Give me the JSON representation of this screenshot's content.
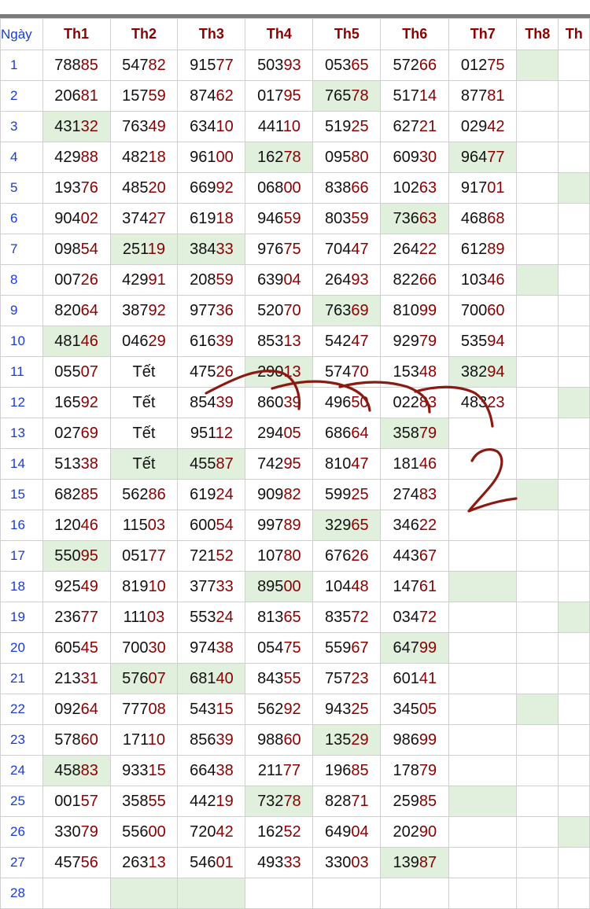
{
  "table": {
    "headers": [
      "Ngày",
      "Th1",
      "Th2",
      "Th3",
      "Th4",
      "Th5",
      "Th6",
      "Th7",
      "Th8",
      "Th"
    ],
    "rows": [
      {
        "day": "1",
        "cells": [
          "78885",
          "54782",
          "91577",
          "50393",
          "05365",
          "57266",
          "01275",
          "",
          ""
        ],
        "hl": [
          7
        ]
      },
      {
        "day": "2",
        "cells": [
          "20681",
          "15759",
          "87462",
          "01795",
          "76578",
          "51714",
          "87781",
          "",
          ""
        ],
        "hl": [
          4
        ]
      },
      {
        "day": "3",
        "cells": [
          "43132",
          "76349",
          "63410",
          "44110",
          "51925",
          "62721",
          "02942",
          "",
          ""
        ],
        "hl": [
          0
        ]
      },
      {
        "day": "4",
        "cells": [
          "42988",
          "48218",
          "96100",
          "16278",
          "09580",
          "60930",
          "96477",
          "",
          ""
        ],
        "hl": [
          3,
          6
        ]
      },
      {
        "day": "5",
        "cells": [
          "19376",
          "48520",
          "66992",
          "06800",
          "83866",
          "10263",
          "91701",
          "",
          ""
        ],
        "hl": [
          8
        ]
      },
      {
        "day": "6",
        "cells": [
          "90402",
          "37427",
          "61918",
          "94659",
          "80359",
          "73663",
          "46868",
          "",
          ""
        ],
        "hl": [
          5
        ]
      },
      {
        "day": "7",
        "cells": [
          "09854",
          "25119",
          "38433",
          "97675",
          "70447",
          "26422",
          "61289",
          "",
          ""
        ],
        "hl": [
          1,
          2
        ]
      },
      {
        "day": "8",
        "cells": [
          "00726",
          "42991",
          "20859",
          "63904",
          "26493",
          "82266",
          "10346",
          "",
          ""
        ],
        "hl": [
          7
        ]
      },
      {
        "day": "9",
        "cells": [
          "82064",
          "38792",
          "97736",
          "52070",
          "76369",
          "81099",
          "70060",
          "",
          ""
        ],
        "hl": [
          4
        ]
      },
      {
        "day": "10",
        "cells": [
          "48146",
          "04629",
          "61639",
          "85313",
          "54247",
          "92979",
          "53594",
          "",
          ""
        ],
        "hl": [
          0
        ]
      },
      {
        "day": "11",
        "cells": [
          "05507",
          "Tết",
          "47526",
          "29013",
          "57470",
          "15348",
          "38294",
          "",
          ""
        ],
        "hl": [
          3,
          6
        ]
      },
      {
        "day": "12",
        "cells": [
          "16592",
          "Tết",
          "85439",
          "86039",
          "49650",
          "02283",
          "48323",
          "",
          ""
        ],
        "hl": [
          8
        ]
      },
      {
        "day": "13",
        "cells": [
          "02769",
          "Tết",
          "95112",
          "29405",
          "68664",
          "35879",
          "",
          "",
          ""
        ],
        "hl": [
          5
        ]
      },
      {
        "day": "14",
        "cells": [
          "51338",
          "Tết",
          "45587",
          "74295",
          "81047",
          "18146",
          "",
          "",
          ""
        ],
        "hl": [
          1,
          2
        ]
      },
      {
        "day": "15",
        "cells": [
          "68285",
          "56286",
          "61924",
          "90982",
          "59925",
          "27483",
          "",
          "",
          ""
        ],
        "hl": [
          7
        ]
      },
      {
        "day": "16",
        "cells": [
          "12046",
          "11503",
          "60054",
          "99789",
          "32965",
          "34622",
          "",
          "",
          ""
        ],
        "hl": [
          4
        ]
      },
      {
        "day": "17",
        "cells": [
          "55095",
          "05177",
          "72152",
          "10780",
          "67626",
          "44367",
          "",
          "",
          ""
        ],
        "hl": [
          0
        ]
      },
      {
        "day": "18",
        "cells": [
          "92549",
          "81910",
          "37733",
          "89500",
          "10448",
          "14761",
          "",
          "",
          ""
        ],
        "hl": [
          3,
          6
        ]
      },
      {
        "day": "19",
        "cells": [
          "23677",
          "11103",
          "55324",
          "81365",
          "83572",
          "03472",
          "",
          "",
          ""
        ],
        "hl": [
          8
        ]
      },
      {
        "day": "20",
        "cells": [
          "60545",
          "70030",
          "97438",
          "05475",
          "55967",
          "64799",
          "",
          "",
          ""
        ],
        "hl": [
          5
        ]
      },
      {
        "day": "21",
        "cells": [
          "21331",
          "57607",
          "68140",
          "84355",
          "75723",
          "60141",
          "",
          "",
          ""
        ],
        "hl": [
          1,
          2
        ]
      },
      {
        "day": "22",
        "cells": [
          "09264",
          "77708",
          "54315",
          "56292",
          "94325",
          "34505",
          "",
          "",
          ""
        ],
        "hl": [
          7
        ]
      },
      {
        "day": "23",
        "cells": [
          "57860",
          "17110",
          "85639",
          "98860",
          "13529",
          "98699",
          "",
          "",
          ""
        ],
        "hl": [
          4
        ]
      },
      {
        "day": "24",
        "cells": [
          "45883",
          "93315",
          "66438",
          "21177",
          "19685",
          "17879",
          "",
          "",
          ""
        ],
        "hl": [
          0
        ]
      },
      {
        "day": "25",
        "cells": [
          "00157",
          "35855",
          "44219",
          "73278",
          "82871",
          "25985",
          "",
          "",
          ""
        ],
        "hl": [
          3,
          6
        ]
      },
      {
        "day": "26",
        "cells": [
          "33079",
          "55600",
          "72042",
          "16252",
          "64904",
          "20290",
          "",
          "",
          ""
        ],
        "hl": [
          8
        ]
      },
      {
        "day": "27",
        "cells": [
          "45756",
          "26313",
          "54601",
          "49333",
          "33003",
          "13987",
          "",
          "",
          ""
        ],
        "hl": [
          5
        ]
      },
      {
        "day": "28",
        "cells": [
          "",
          "",
          "",
          "",
          "",
          "",
          "",
          "",
          ""
        ],
        "hl": [
          1,
          2
        ]
      }
    ]
  },
  "annotation": {
    "handwritten_text": "2",
    "color": "#8b1a12"
  },
  "colors": {
    "header_text": "#8b0000",
    "day_text": "#1a3ccf",
    "digit_tail": "#8b0000",
    "highlight": "#e0f0dd",
    "grid_line": "#d0d0d0"
  }
}
